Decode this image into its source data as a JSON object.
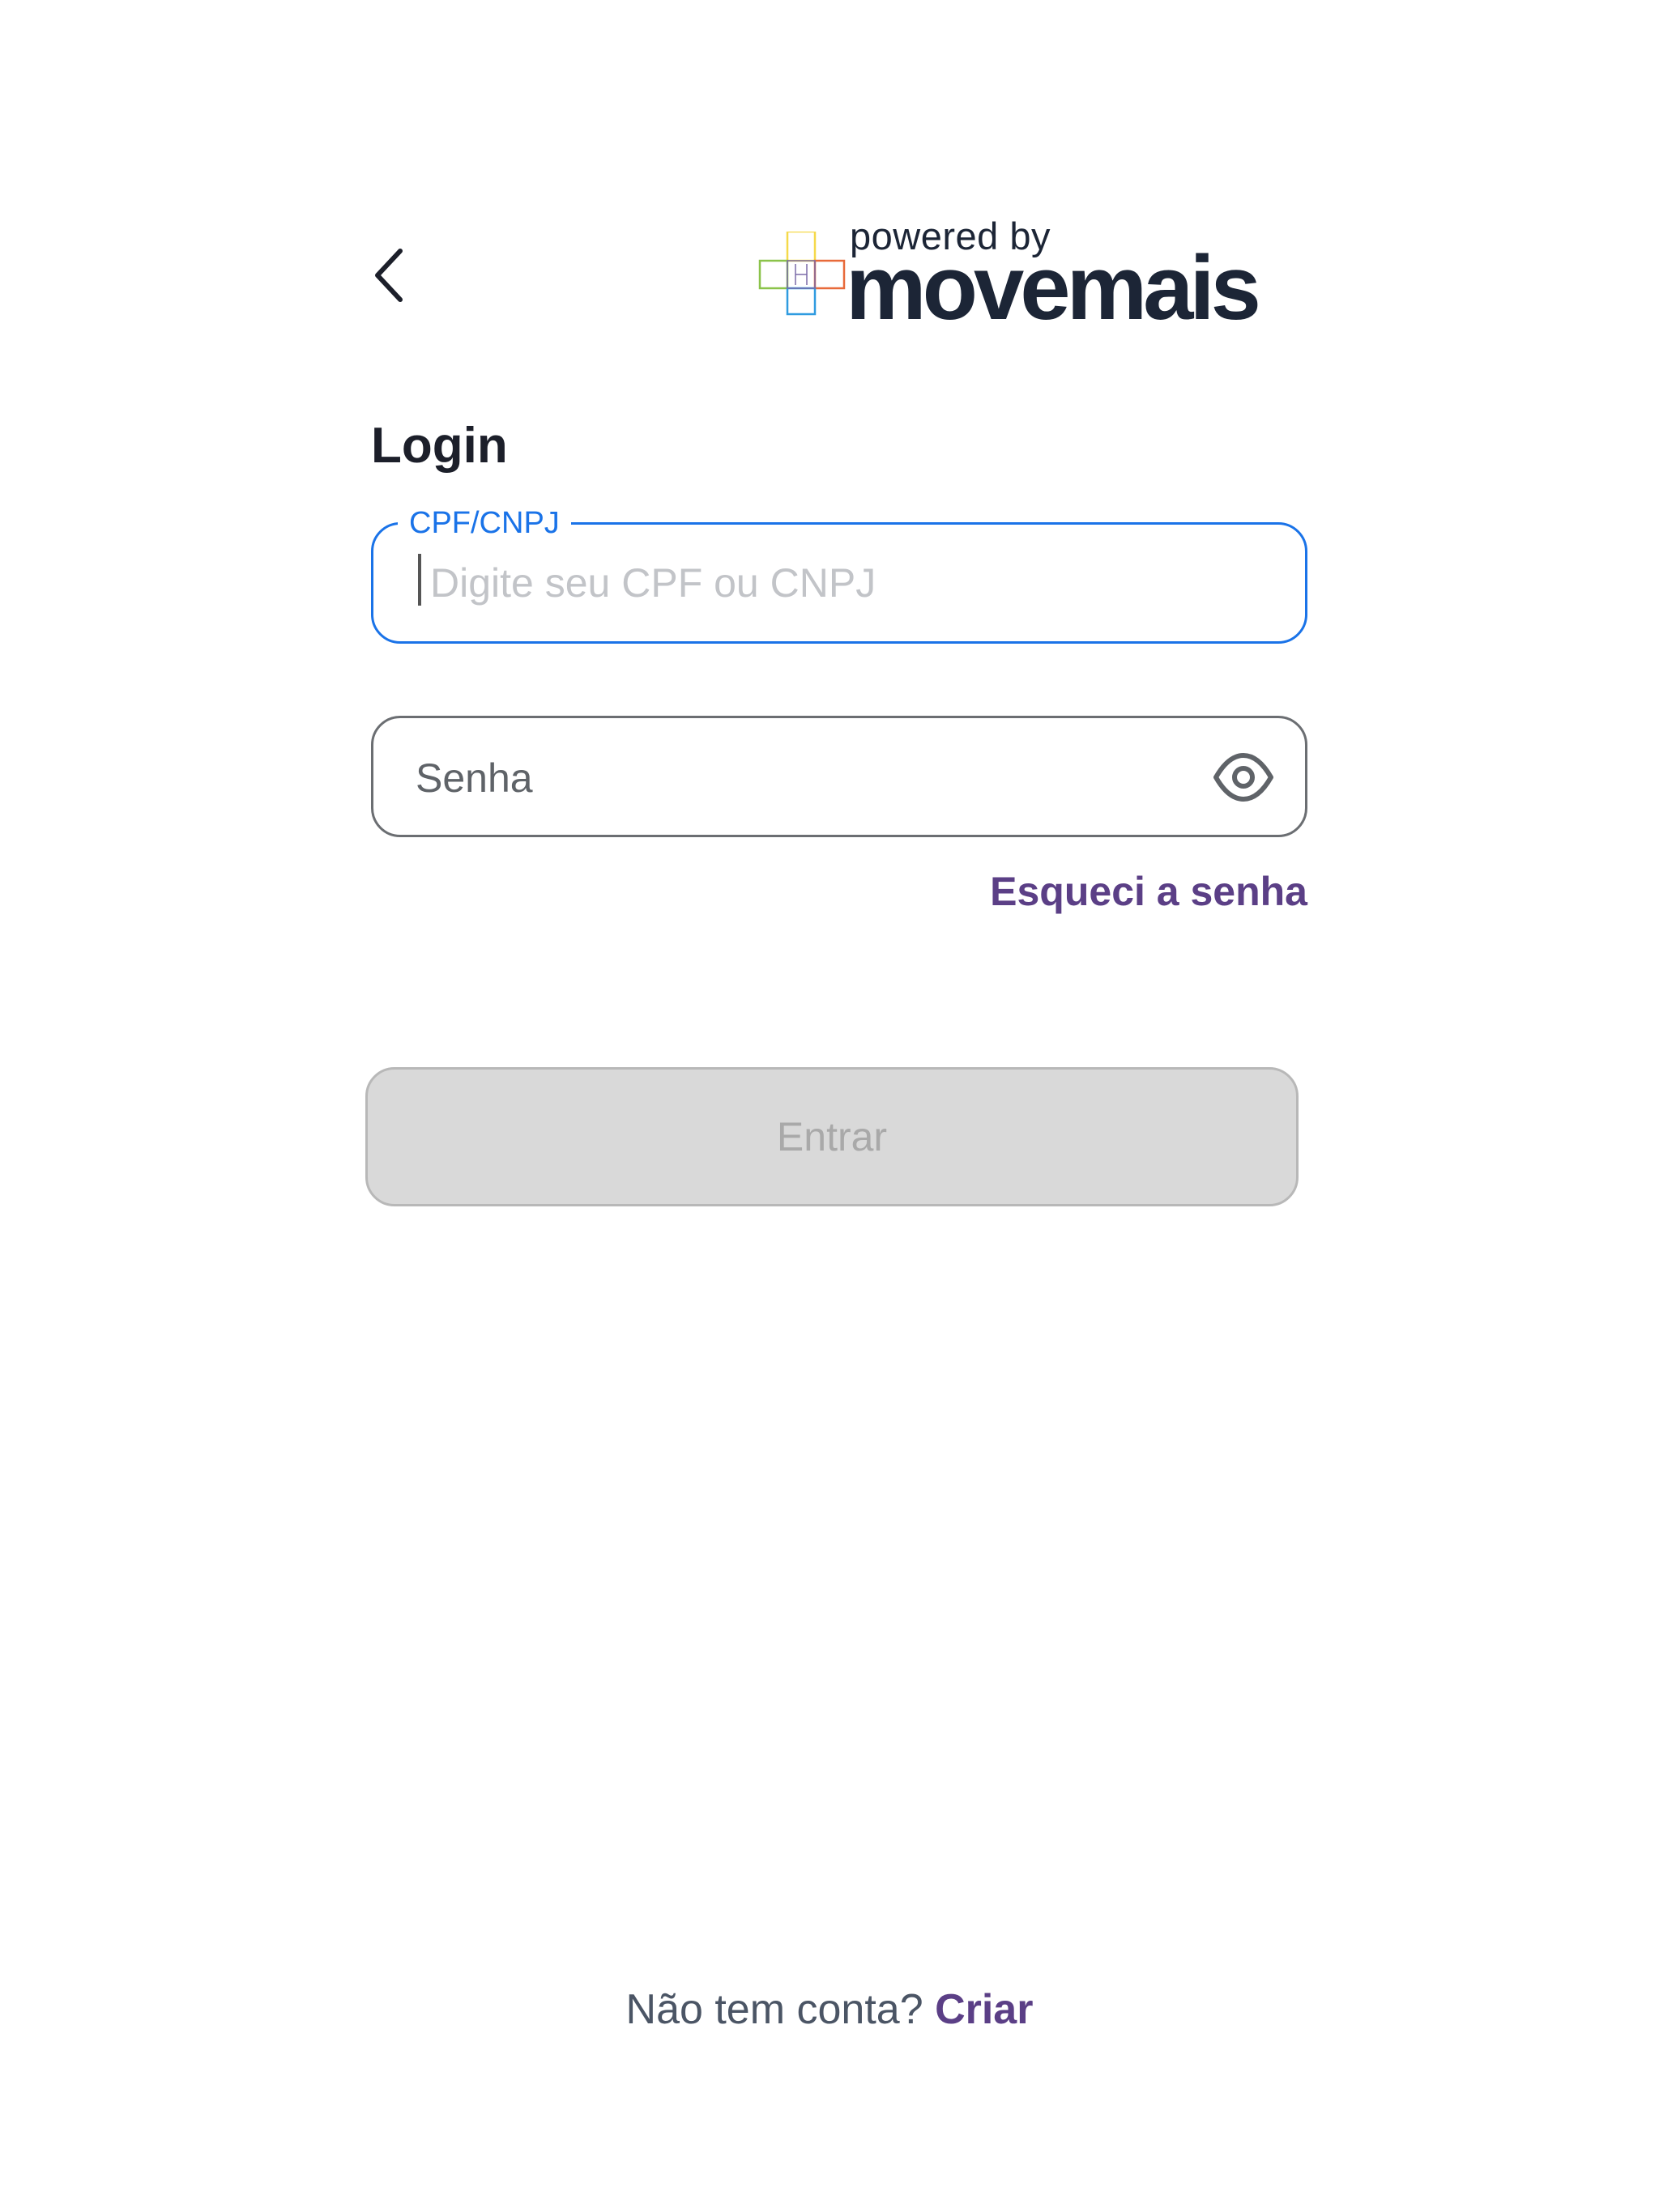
{
  "header": {
    "back_icon": "chevron-left-icon",
    "logo": {
      "tagline": "powered by",
      "wordmark": "movemais",
      "colors": [
        "#f5d94a",
        "#e86a3a",
        "#8bc34a",
        "#2f9be0"
      ]
    }
  },
  "form": {
    "title": "Login",
    "cpf": {
      "label": "CPF/CNPJ",
      "placeholder": "Digite seu CPF ou CNPJ",
      "value": "",
      "focused_color": "#1a73e8"
    },
    "password": {
      "placeholder": "Senha",
      "value": "",
      "toggle_icon": "eye-icon"
    },
    "forgot_label": "Esqueci a senha",
    "submit_label": "Entrar"
  },
  "footer": {
    "prompt": "Não tem conta?",
    "link_label": "Criar"
  },
  "colors": {
    "accent": "#5b3f86",
    "focus": "#1a73e8",
    "text_dark": "#1c1f2a",
    "disabled_bg": "#d9d9d9"
  }
}
